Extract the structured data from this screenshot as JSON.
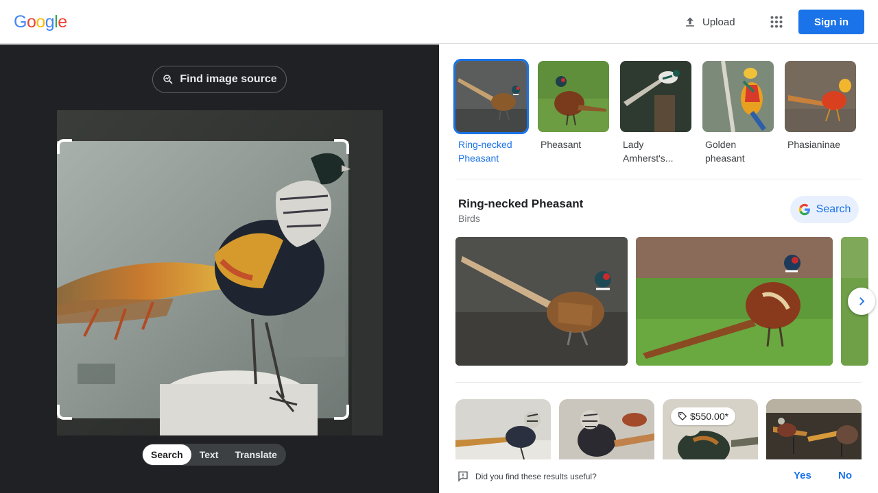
{
  "header": {
    "logo_letters": [
      "G",
      "o",
      "o",
      "g",
      "l",
      "e"
    ],
    "upload_label": "Upload",
    "signin_label": "Sign in"
  },
  "lens": {
    "find_source_label": "Find image source",
    "modes": [
      "Search",
      "Text",
      "Translate"
    ],
    "active_mode": "Search"
  },
  "related": {
    "chips": [
      {
        "label": "Ring-necked Pheasant",
        "active": true
      },
      {
        "label": "Pheasant",
        "active": false
      },
      {
        "label": "Lady Amherst's...",
        "active": false
      },
      {
        "label": "Golden pheasant",
        "active": false
      },
      {
        "label": "Phasianinae",
        "active": false
      }
    ]
  },
  "knowledge": {
    "title": "Ring-necked Pheasant",
    "subtitle": "Birds",
    "search_label": "Search"
  },
  "visual_matches": {
    "price_badge": "$550.00*"
  },
  "feedback": {
    "question": "Did you find these results useful?",
    "yes": "Yes",
    "no": "No"
  },
  "colors": {
    "accent": "#1a73e8",
    "dark_panel": "#202124",
    "google_blue": "#4285F4",
    "google_red": "#EA4335",
    "google_yellow": "#FBBC05",
    "google_green": "#34A853"
  }
}
